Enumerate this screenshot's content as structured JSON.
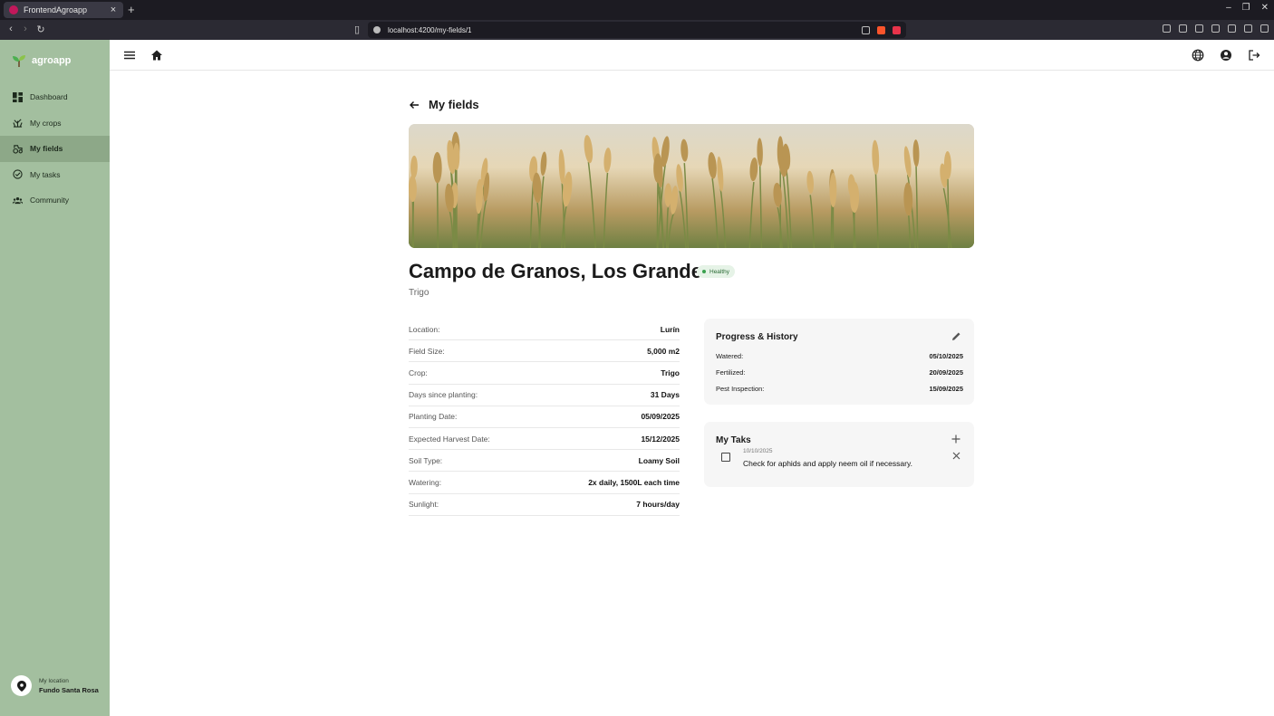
{
  "browser": {
    "tab_title": "FrontendAgroapp",
    "url": "localhost:4200/my-fields/1"
  },
  "sidebar": {
    "brand": "agroapp",
    "items": [
      {
        "label": "Dashboard",
        "icon": "dashboard-icon"
      },
      {
        "label": "My crops",
        "icon": "crops-icon"
      },
      {
        "label": "My fields",
        "icon": "tractor-icon",
        "active": true
      },
      {
        "label": "My tasks",
        "icon": "check-circle-icon"
      },
      {
        "label": "Community",
        "icon": "group-icon"
      }
    ],
    "location_label": "My location",
    "location_value": "Fundo Santa Rosa"
  },
  "page": {
    "back_title": "My fields",
    "field_name": "Campo de Granos, Los Grandes",
    "status": "Healthy",
    "crop_subtitle": "Trigo"
  },
  "details": [
    {
      "label": "Location:",
      "value": "Lurín"
    },
    {
      "label": "Field Size:",
      "value": "5,000 m2"
    },
    {
      "label": "Crop:",
      "value": "Trigo"
    },
    {
      "label": "Days since planting:",
      "value": "31 Days"
    },
    {
      "label": "Planting Date:",
      "value": "05/09/2025"
    },
    {
      "label": "Expected Harvest Date:",
      "value": "15/12/2025"
    },
    {
      "label": "Soil Type:",
      "value": "Loamy Soil"
    },
    {
      "label": "Watering:",
      "value": "2x daily, 1500L each time"
    },
    {
      "label": "Sunlight:",
      "value": "7 hours/day"
    }
  ],
  "progress": {
    "title": "Progress & History",
    "rows": [
      {
        "label": "Watered:",
        "value": "05/10/2025"
      },
      {
        "label": "Fertilized:",
        "value": "20/09/2025"
      },
      {
        "label": "Pest Inspection:",
        "value": "15/09/2025"
      }
    ]
  },
  "tasks": {
    "title": "My Taks",
    "items": [
      {
        "date": "10/10/2025",
        "text": "Check for aphids and apply neem oil if necessary."
      }
    ]
  },
  "colors": {
    "sidebar_bg": "#a3bf9f",
    "sidebar_active": "#8da888",
    "badge_bg": "#e6f3e7",
    "badge_text": "#2a6b35"
  }
}
